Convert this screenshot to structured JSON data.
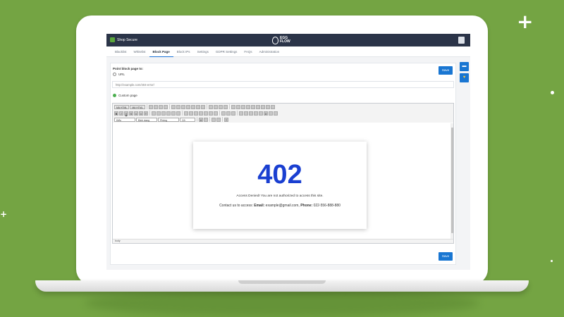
{
  "app": {
    "brand": "Shop Secure",
    "logo_text_1": "EGG",
    "logo_text_2": "FLOW"
  },
  "nav": {
    "tabs": [
      "Blacklist",
      "Whitelist",
      "Block Page",
      "Block IPs",
      "Settings",
      "GDPR Settings",
      "FAQs",
      "Administration"
    ],
    "active": "Block Page"
  },
  "form": {
    "point_label": "Point block page to:",
    "url_option": "URL",
    "url_value": "http://example.com/404-error/",
    "custom_option": "Custom page",
    "save_label": "Save"
  },
  "toolbar": {
    "row1_buttons": [
      "Mã HTML",
      "Mã HTML"
    ],
    "selects": [
      "Kiểu",
      "Định dạng",
      "Phông",
      "Cỡ"
    ]
  },
  "editor": {
    "status_path": "body",
    "error_code": "402",
    "message": "Access Denied! You are not authorized to access this site.",
    "contact_prefix": "Contact us to access:",
    "email_label": "Email:",
    "email_value": "example@gmail.com,",
    "phone_label": "Phone:",
    "phone_value": "022-556-888-880"
  },
  "colors": {
    "background": "#74a443",
    "topbar": "#2b3448",
    "accent": "#1976d2",
    "code_color": "#1a3fd1"
  },
  "icons": [
    "plus-icon",
    "chat-icon",
    "heart-icon",
    "user-avatar-icon"
  ]
}
